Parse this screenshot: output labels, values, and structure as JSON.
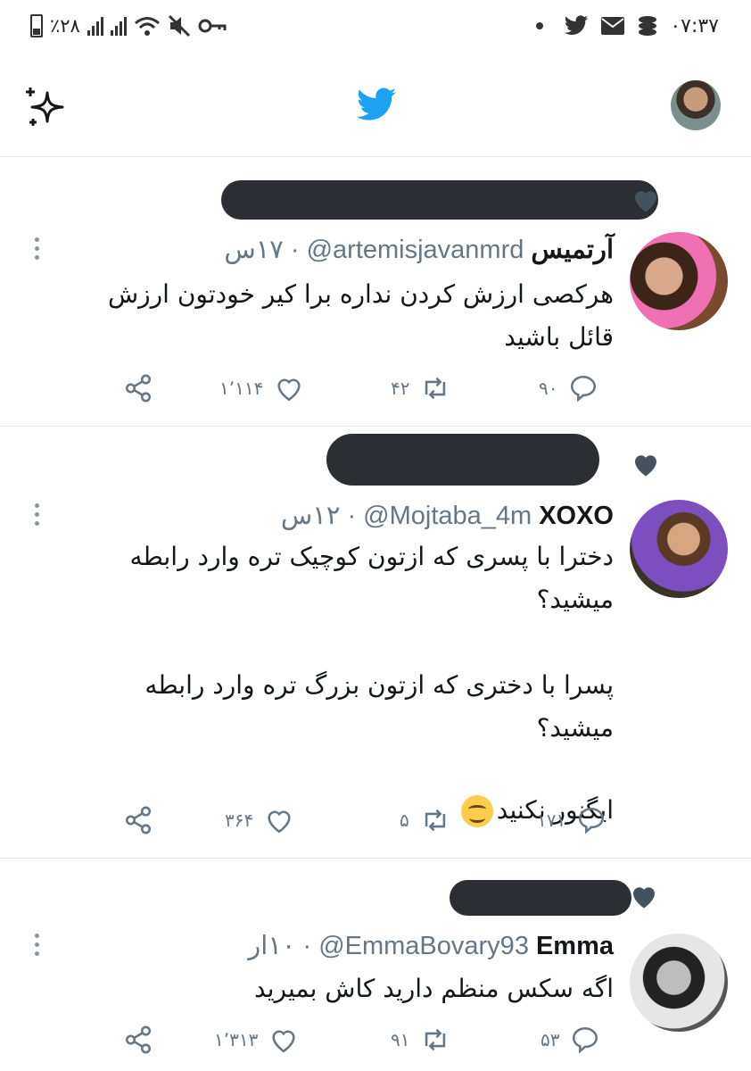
{
  "status_bar": {
    "battery_text": "٪۲۸",
    "time": "۰۷:۳۷"
  },
  "header": {
    "sparkle_icon": "sparkle-icon",
    "logo_icon": "twitter-bird-icon",
    "brand_color": "#1da1f2"
  },
  "tweets": [
    {
      "name": "آرتمیس",
      "handle": "@artemisjavanmrd",
      "time": "· ۱۷س",
      "text": "هرکصی ارزش کردن نداره برا کیر خودتون ارزش\nقائل باشید",
      "replies": "۹۰",
      "retweets": "۴۲",
      "likes": "۱٬۱۱۴"
    },
    {
      "name": "XOXO",
      "handle": "@Mojtaba_4m",
      "time": "· ۱۲س",
      "text": "دخترا با پسری که ازتون کوچیک تره وارد رابطه\nمیشید؟\n\nپسرا با دختری که ازتون بزرگ تره وارد رابطه\nمیشید؟",
      "text_last": "ایگنور نکنید",
      "replies": "۱۷۱",
      "retweets": "۵",
      "likes": "۳۶۴"
    },
    {
      "name": "Emma",
      "handle": "@EmmaBovary93",
      "time": "· ۱۰ار",
      "text": "اگه سکس منظم دارید کاش بمیرید",
      "replies": "۵۳",
      "retweets": "۹۱",
      "likes": "۱٬۳۱۳"
    }
  ]
}
